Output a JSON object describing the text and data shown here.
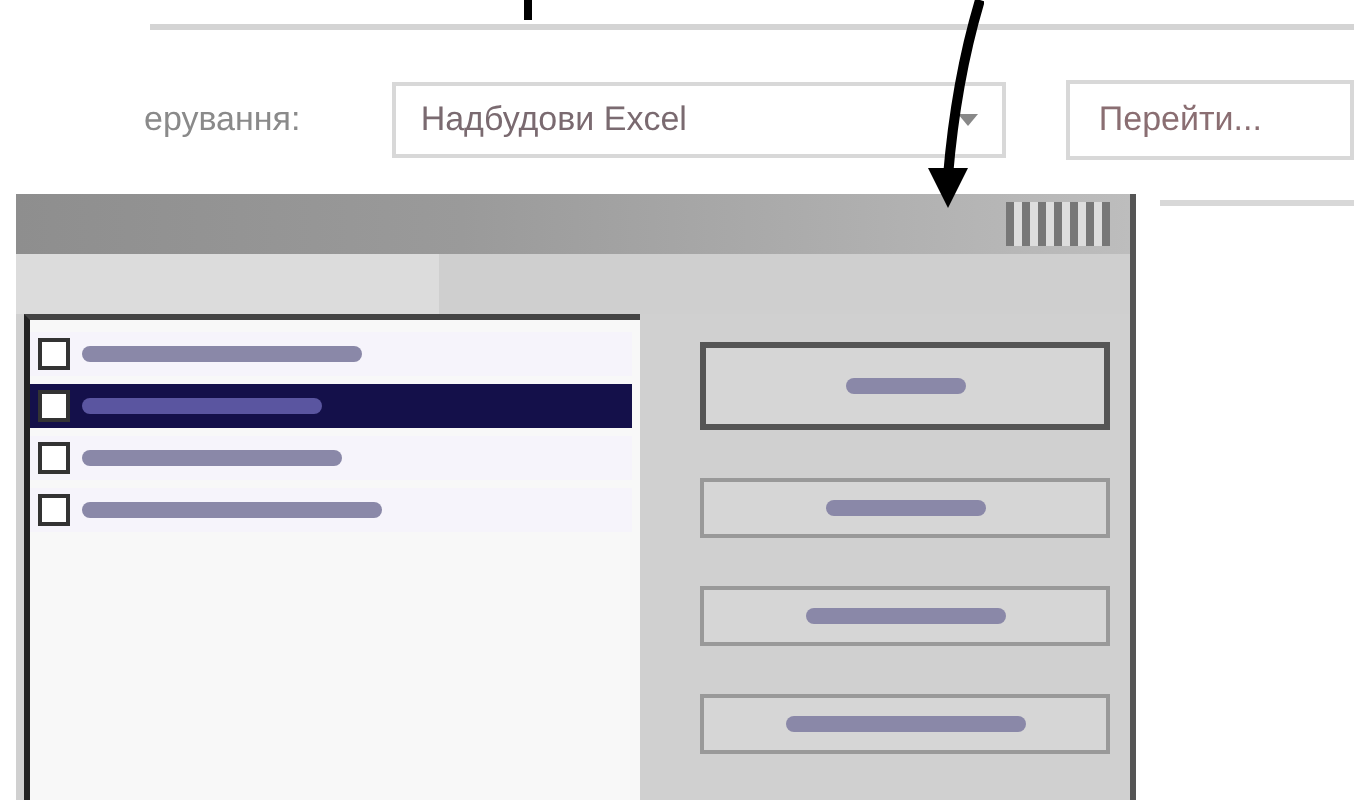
{
  "manage_label": "ерування:",
  "manage_select": {
    "value": "Надбудови Excel"
  },
  "go_button": "Перейти...",
  "dialog": {
    "list_rows": [
      {
        "selected": false
      },
      {
        "selected": true
      },
      {
        "selected": false
      },
      {
        "selected": false
      }
    ],
    "buttons": [
      {
        "kind": "default"
      },
      {
        "kind": "plain"
      },
      {
        "kind": "plain"
      },
      {
        "kind": "plain"
      }
    ]
  }
}
